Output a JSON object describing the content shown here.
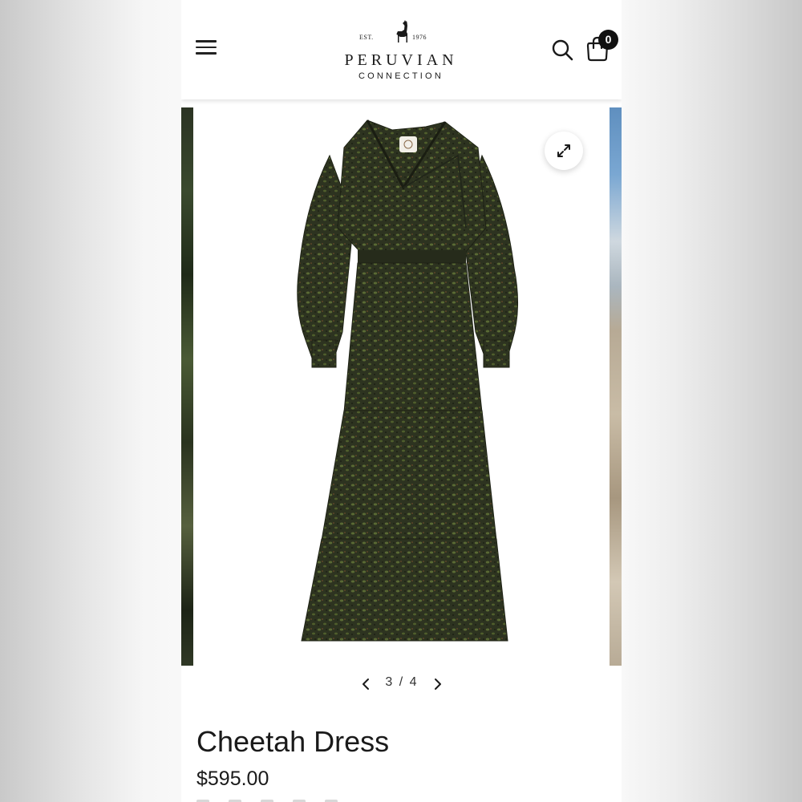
{
  "header": {
    "menu_icon": "hamburger-menu-icon",
    "logo": {
      "est": "EST.",
      "year": "1976",
      "name": "PERUVIAN",
      "subtitle": "CONNECTION",
      "mark_icon": "llama-icon"
    },
    "search_icon": "search-icon",
    "cart_icon": "shopping-bag-icon",
    "cart_count": "0"
  },
  "gallery": {
    "expand_icon": "expand-icon",
    "current": "3",
    "total": "4",
    "counter": "3 / 4",
    "prev_icon": "chevron-left-icon",
    "next_icon": "chevron-right-icon"
  },
  "product": {
    "title": "Cheetah Dress",
    "price": "$595.00"
  },
  "colors": {
    "text": "#1a1a1a",
    "badge": "#111111",
    "dress": "#2f3420"
  }
}
